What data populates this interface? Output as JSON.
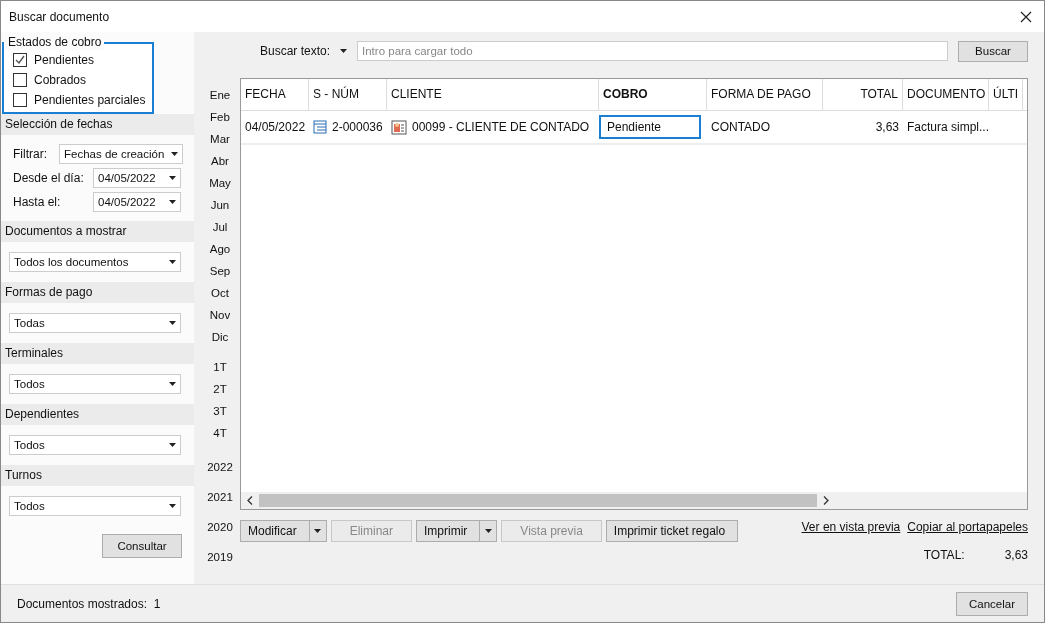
{
  "window": {
    "title": "Buscar documento"
  },
  "payment_states": {
    "header": "Estados de cobro",
    "items": [
      {
        "label": "Pendientes",
        "checked": true
      },
      {
        "label": "Cobrados",
        "checked": false
      },
      {
        "label": "Pendientes parciales",
        "checked": false
      }
    ]
  },
  "date_selection": {
    "header": "Selección de fechas",
    "filter_label": "Filtrar:",
    "filter_value": "Fechas de creación",
    "from_label": "Desde el día:",
    "from_value": "04/05/2022",
    "to_label": "Hasta el:",
    "to_value": "04/05/2022"
  },
  "filters": [
    {
      "header": "Documentos a mostrar",
      "value": "Todos los documentos"
    },
    {
      "header": "Formas de pago",
      "value": "Todas"
    },
    {
      "header": "Terminales",
      "value": "Todos"
    },
    {
      "header": "Dependientes",
      "value": "Todos"
    },
    {
      "header": "Turnos",
      "value": "Todos"
    }
  ],
  "consult_button": "Consultar",
  "search": {
    "label": "Buscar texto:",
    "placeholder": "Intro para cargar todo",
    "button": "Buscar"
  },
  "periods": {
    "months": [
      "Ene",
      "Feb",
      "Mar",
      "Abr",
      "May",
      "Jun",
      "Jul",
      "Ago",
      "Sep",
      "Oct",
      "Nov",
      "Dic"
    ],
    "quarters": [
      "1T",
      "2T",
      "3T",
      "4T"
    ],
    "years": [
      "2022",
      "2021",
      "2020",
      "2019"
    ]
  },
  "table": {
    "columns": [
      {
        "label": "FECHA",
        "sorted": false
      },
      {
        "label": "S - NÚM",
        "sorted": false
      },
      {
        "label": "CLIENTE",
        "sorted": false
      },
      {
        "label": "COBRO",
        "sorted": true
      },
      {
        "label": "FORMA DE PAGO",
        "sorted": false
      },
      {
        "label": "TOTAL",
        "sorted": false
      },
      {
        "label": "DOCUMENTO",
        "sorted": false
      },
      {
        "label": "ÚLTI",
        "sorted": false
      }
    ],
    "rows": [
      {
        "cells": [
          {
            "text": "04/05/2022",
            "focused": false,
            "kind": "text"
          },
          {
            "text": "2-000036",
            "focused": false,
            "kind": "document"
          },
          {
            "text": "00099 - CLIENTE DE CONTADO",
            "focused": false,
            "kind": "client"
          },
          {
            "text": "Pendiente",
            "focused": true,
            "kind": "text"
          },
          {
            "text": "CONTADO",
            "focused": false,
            "kind": "text"
          },
          {
            "text": "3,63",
            "focused": false,
            "kind": "text"
          },
          {
            "text": "Factura simpl...",
            "focused": false,
            "kind": "text"
          }
        ]
      }
    ]
  },
  "actions": [
    {
      "label": "Modificar",
      "kind": "split",
      "disabled": false
    },
    {
      "label": "Eliminar",
      "kind": "plain",
      "disabled": true
    },
    {
      "label": "Imprimir",
      "kind": "split",
      "disabled": false
    },
    {
      "label": "Vista previa",
      "kind": "plain",
      "disabled": true
    },
    {
      "label": "Imprimir ticket regalo",
      "kind": "plain",
      "disabled": false
    }
  ],
  "links": [
    "Ver en vista previa",
    "Copiar al portapapeles"
  ],
  "total": {
    "label": "TOTAL:",
    "value": "3,63"
  },
  "status_bar": {
    "label": "Documentos mostrados:",
    "value": "1"
  },
  "cancel_button": "Cancelar"
}
